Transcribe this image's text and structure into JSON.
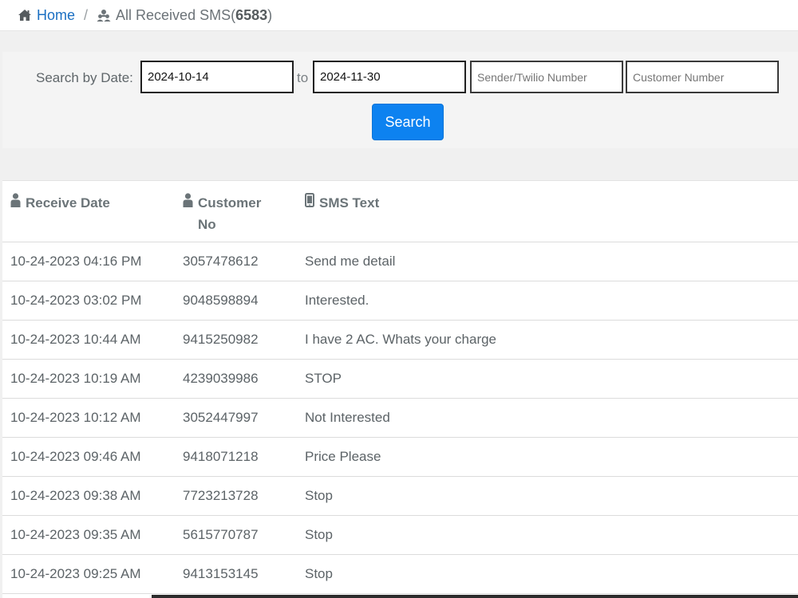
{
  "breadcrumb": {
    "home_label": "Home",
    "separator": "/",
    "current_label": "All Received SMS(",
    "count": "6583",
    "count_close": ")"
  },
  "search": {
    "label": "Search by Date:",
    "date_from": "2024-10-14",
    "to_label": "to",
    "date_to": "2024-11-30",
    "sender_placeholder": "Sender/Twilio Number",
    "customer_placeholder": "Customer Number",
    "button_label": "Search"
  },
  "table": {
    "headers": {
      "receive_date": "Receive Date",
      "customer_no": "Customer No",
      "sms_text": "SMS Text"
    },
    "rows": [
      {
        "date": "10-24-2023 04:16 PM",
        "customer": "3057478612",
        "text": "Send me detail"
      },
      {
        "date": "10-24-2023 03:02 PM",
        "customer": "9048598894",
        "text": "Interested."
      },
      {
        "date": "10-24-2023 10:44 AM",
        "customer": "9415250982",
        "text": "I have 2 AC. Whats your charge"
      },
      {
        "date": "10-24-2023 10:19 AM",
        "customer": "4239039986",
        "text": "STOP"
      },
      {
        "date": "10-24-2023 10:12 AM",
        "customer": "3052447997",
        "text": "Not Interested"
      },
      {
        "date": "10-24-2023 09:46 AM",
        "customer": "9418071218",
        "text": "Price Please"
      },
      {
        "date": "10-24-2023 09:38 AM",
        "customer": "7723213728",
        "text": "Stop"
      },
      {
        "date": "10-24-2023 09:35 AM",
        "customer": "5615770787",
        "text": "Stop"
      },
      {
        "date": "10-24-2023 09:25 AM",
        "customer": "9413153145",
        "text": "Stop"
      }
    ]
  },
  "icons": {
    "home": "home-icon",
    "users": "users-icon",
    "user": "user-icon",
    "mobile": "mobile-icon"
  },
  "colors": {
    "link": "#1b6fc2",
    "button": "#0d82f0"
  }
}
